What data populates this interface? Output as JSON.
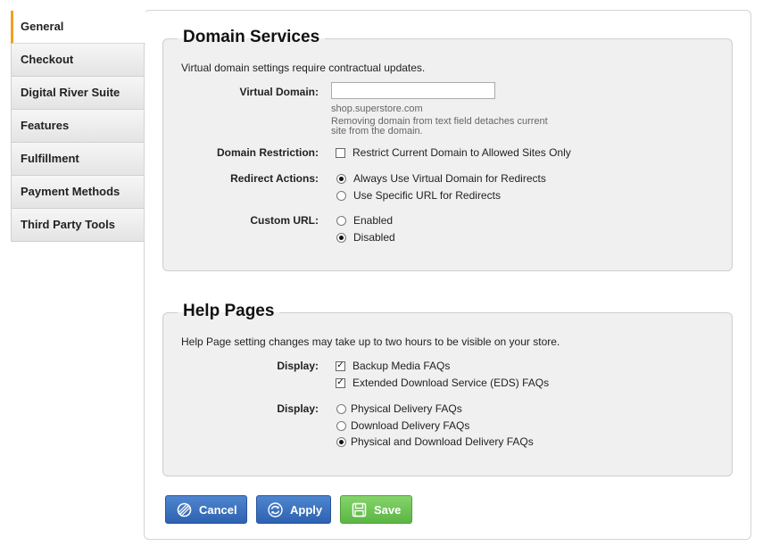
{
  "sidebar": {
    "items": [
      {
        "label": "General",
        "active": true
      },
      {
        "label": "Checkout"
      },
      {
        "label": "Digital River Suite"
      },
      {
        "label": "Features"
      },
      {
        "label": "Fulfillment"
      },
      {
        "label": "Payment Methods"
      },
      {
        "label": "Third Party Tools"
      }
    ],
    "active_color": "#f0a020"
  },
  "domain_services": {
    "title": "Domain Services",
    "note": "Virtual domain settings require contractual updates.",
    "virtual_domain_label": "Virtual Domain:",
    "virtual_domain_value": "",
    "virtual_domain_hint1": "shop.superstore.com",
    "virtual_domain_hint2": "Removing domain from text field detaches current",
    "virtual_domain_hint3": "site from the domain.",
    "restriction_label": "Domain Restriction:",
    "restriction_option": "Restrict Current Domain to Allowed Sites Only",
    "restriction_checked": false,
    "redirect_label": "Redirect Actions:",
    "redirect_options": [
      "Always Use Virtual Domain for Redirects",
      "Use Specific URL for Redirects"
    ],
    "redirect_selected": "Always Use Virtual Domain for Redirects",
    "custom_url_label": "Custom URL:",
    "custom_url_options": [
      "Enabled",
      "Disabled"
    ],
    "custom_url_selected": "Disabled"
  },
  "help_pages": {
    "title": "Help Pages",
    "note": "Help Page setting changes may take up to two hours to be visible on your store.",
    "display_label_1": "Display:",
    "checkbox_options": [
      "Backup Media FAQs",
      "Extended Download Service (EDS) FAQs"
    ],
    "checkbox_checked": [
      true,
      true
    ],
    "display_label_2": "Display:",
    "radio_options": [
      "Physical Delivery FAQs",
      "Download Delivery FAQs",
      "Physical and Download Delivery FAQs"
    ],
    "radio_selected": "Physical and Download Delivery FAQs"
  },
  "buttons": {
    "cancel": "Cancel",
    "apply": "Apply",
    "save": "Save",
    "blue": "#3a70c0",
    "green": "#6cc455"
  },
  "icons": {
    "cancel": "cancel-circle-icon",
    "apply": "refresh-icon",
    "save": "floppy-disk-icon"
  }
}
